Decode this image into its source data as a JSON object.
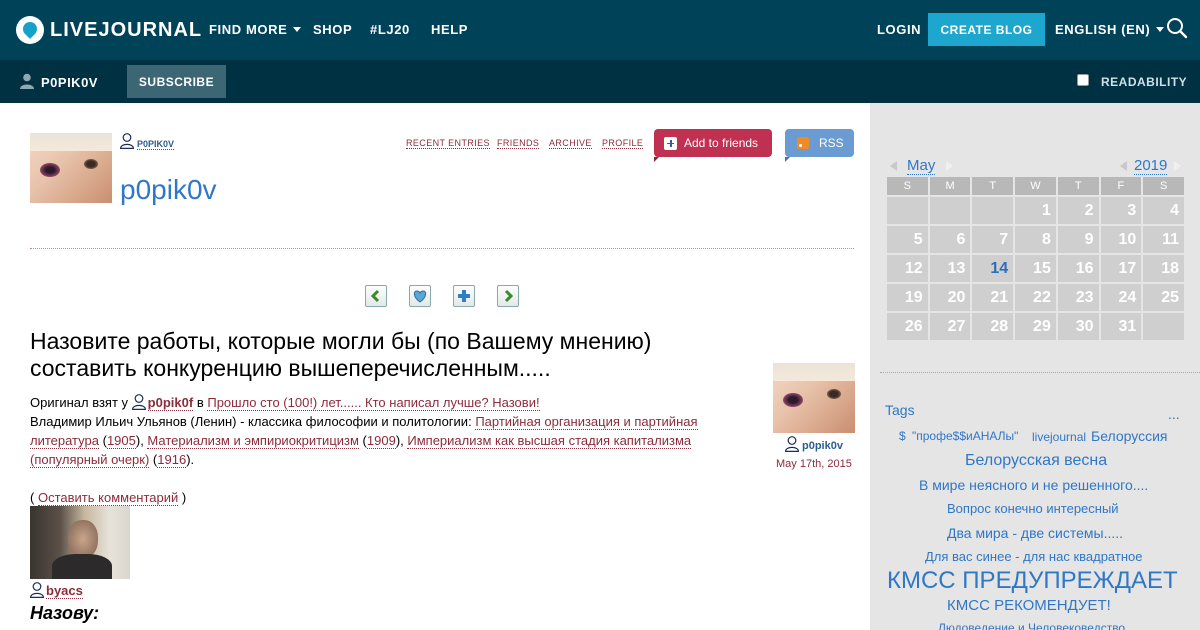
{
  "header": {
    "logo_text": "LIVEJOURNAL",
    "nav": [
      {
        "label": "FIND MORE",
        "dropdown": true
      },
      {
        "label": "SHOP"
      },
      {
        "label": "#LJ20"
      },
      {
        "label": "HELP"
      }
    ],
    "login_label": "LOGIN",
    "create_blog_label": "CREATE BLOG",
    "language_label": "ENGLISH (EN)",
    "icons": {
      "search": "search-icon",
      "logo": "livejournal-logo-icon"
    }
  },
  "subheader": {
    "username": "P0PIK0V",
    "subscribe_label": "SUBSCRIBE",
    "readability_label": "READABILITY"
  },
  "journal": {
    "header_username": "P0PIK0V",
    "title": "p0pik0v",
    "links": [
      "RECENT ENTRIES",
      "FRIENDS",
      "ARCHIVE",
      "PROFILE"
    ],
    "add_friends_label": "Add to friends",
    "rss_label": "RSS"
  },
  "entry_nav": {
    "icons": [
      "previous-entry-icon",
      "memories-icon",
      "tell-a-friend-icon",
      "next-entry-icon"
    ]
  },
  "post": {
    "title": "Назовите работы, которые могли бы (по Вашему мнению) составить конкуренцию вышеперечисленным.....",
    "source_prefix": "Оригинал взят у",
    "source_user": "p0pik0f",
    "source_in": "в",
    "source_link": "Прошло сто (100!) лет...... Кто написал лучше? Назови!",
    "body_text": "Владимир Ильич Ульянов (Ленин) - классика философии и политологии:",
    "works": [
      {
        "title": "Партийная организация и партийная литература",
        "year": "1905"
      },
      {
        "title": "Материализм и эмпириокритицизм",
        "year": "1909"
      },
      {
        "title": "Империализм как высшая стадия капитализма (популярный очерк)",
        "year": "1916"
      }
    ],
    "comment_open": "(",
    "comment_link": "Оставить комментарий",
    "comment_close": ")",
    "author": "p0pik0v",
    "date": "May 17th, 2015"
  },
  "comment": {
    "username": "byacs",
    "text": "Назову:"
  },
  "calendar": {
    "month": "May",
    "year": "2019",
    "weekdays": [
      "S",
      "M",
      "T",
      "W",
      "T",
      "F",
      "S"
    ],
    "days": [
      "",
      "",
      "",
      "1",
      "2",
      "3",
      "4",
      "5",
      "6",
      "7",
      "8",
      "9",
      "10",
      "11",
      "12",
      "13",
      "14",
      "15",
      "16",
      "17",
      "18",
      "19",
      "20",
      "21",
      "22",
      "23",
      "24",
      "25",
      "26",
      "27",
      "28",
      "29",
      "30",
      "31",
      ""
    ],
    "today": "14"
  },
  "tags": {
    "title": "Tags",
    "more": "...",
    "items": [
      "$",
      "\"профе$$иАНАЛы\"",
      "livejournal",
      "Белоруссия",
      "Белорусская весна",
      "В мире неясного и не решенного....",
      "Вопрос конечно интересный",
      "Два мира - две системы.....",
      "Для вас синее - для нас квадратное",
      "КМСС ПРЕДУПРЕЖДАЕТ",
      "КМСС РЕКОМЕНДУЕТ!",
      "Людоведение и Человековедство"
    ]
  },
  "colors": {
    "topbar": "#004359",
    "subbar": "#003143",
    "accent": "#1da7cf",
    "link": "#8b2b3b",
    "blue_link": "#2f77c7",
    "add_friends": "#c03050",
    "rss": "#6a9bd3"
  }
}
